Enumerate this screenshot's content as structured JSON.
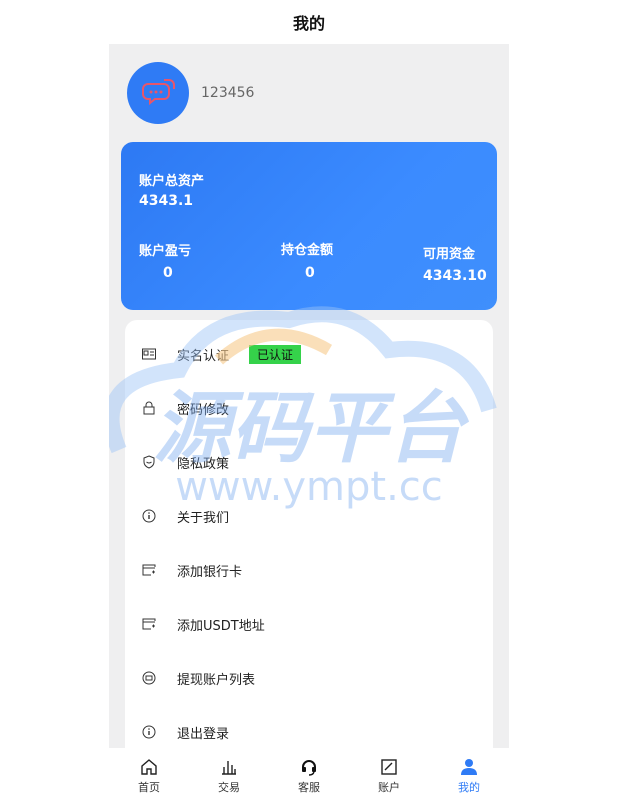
{
  "header": {
    "title": "我的"
  },
  "profile": {
    "username": "123456",
    "avatar_icon": "chat-bubbles-icon"
  },
  "assets_card": {
    "total_label": "账户总资产",
    "total_value": "4343.1",
    "pnl_label": "账户盈亏",
    "pnl_value": "0",
    "position_label": "持仓金额",
    "position_value": "0",
    "available_label": "可用资金",
    "available_value": "4343.10"
  },
  "menu": {
    "items": [
      {
        "label": "实名认证",
        "icon": "id-card-icon",
        "badge": "已认证"
      },
      {
        "label": "密码修改",
        "icon": "lock-icon"
      },
      {
        "label": "隐私政策",
        "icon": "shield-icon"
      },
      {
        "label": "关于我们",
        "icon": "info-icon"
      },
      {
        "label": "添加银行卡",
        "icon": "card-icon"
      },
      {
        "label": "添加USDT地址",
        "icon": "card-icon"
      },
      {
        "label": "提现账户列表",
        "icon": "wallet-icon"
      },
      {
        "label": "退出登录",
        "icon": "info-icon"
      }
    ]
  },
  "watermark": {
    "text": "源码平台",
    "url": "www.ympt.cc"
  },
  "tabbar": {
    "tabs": [
      {
        "label": "首页",
        "icon": "home-icon"
      },
      {
        "label": "交易",
        "icon": "bar-chart-icon"
      },
      {
        "label": "客服",
        "icon": "headset-icon"
      },
      {
        "label": "账户",
        "icon": "chart-box-icon"
      },
      {
        "label": "我的",
        "icon": "user-icon",
        "active": true
      }
    ]
  },
  "colors": {
    "accent": "#2f7bf5",
    "badge_green": "#35d24a",
    "background": "#efeff0"
  }
}
